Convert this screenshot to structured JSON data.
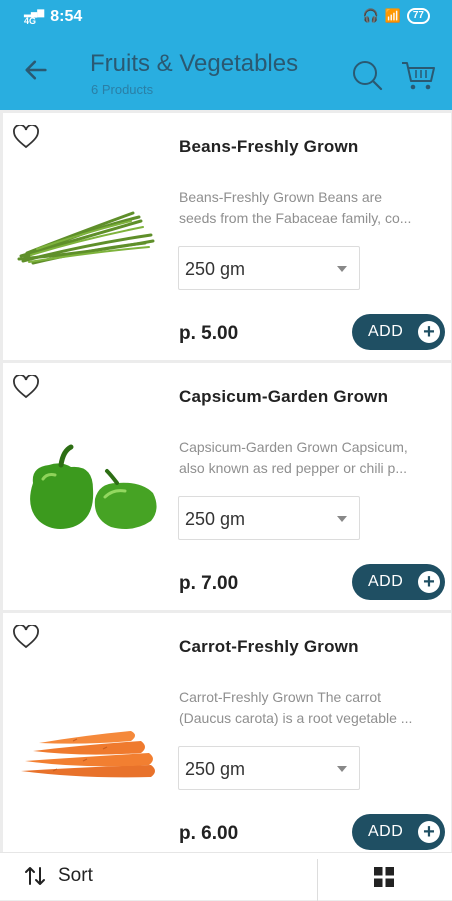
{
  "status": {
    "time": "8:54",
    "signal": "4G",
    "battery": "77"
  },
  "header": {
    "title": "Fruits & Vegetables",
    "subtitle": "6 Products"
  },
  "products": [
    {
      "name": "Beans-Freshly Grown",
      "desc1": "Beans-Freshly Grown Beans are",
      "desc2": "seeds from the Fabaceae family, co...",
      "qty": "250 gm",
      "price": "p. 5.00",
      "add": "ADD"
    },
    {
      "name": "Capsicum-Garden Grown",
      "desc1": "Capsicum-Garden Grown Capsicum,",
      "desc2": "also known as red pepper or chili p...",
      "qty": "250 gm",
      "price": "p. 7.00",
      "add": "ADD"
    },
    {
      "name": "Carrot-Freshly Grown",
      "desc1": "Carrot-Freshly Grown The carrot",
      "desc2": "(Daucus carota) is a root vegetable ...",
      "qty": "250 gm",
      "price": "p. 6.00",
      "add": "ADD"
    }
  ],
  "bottom": {
    "sort_label": "Sort"
  },
  "colors": {
    "accent": "#29aee0",
    "button": "#1f4f63"
  },
  "icons": [
    "back-arrow-icon",
    "search-icon",
    "cart-icon",
    "heart-icon",
    "plus-icon",
    "sort-icon",
    "grid-icon"
  ]
}
